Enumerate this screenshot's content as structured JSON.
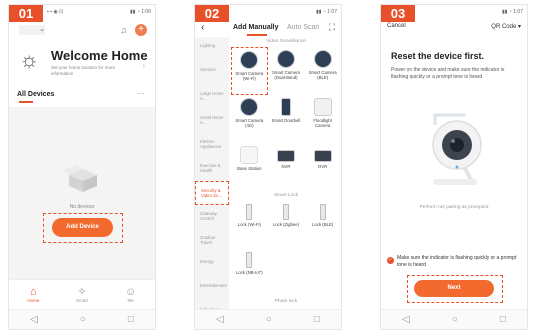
{
  "colors": {
    "accent": "#e8502a",
    "button": "#f36a2e",
    "panel": "#f4f4f4"
  },
  "screen1": {
    "step": "01",
    "welcome_title": "Welcome Home",
    "welcome_sub": "Set your home location for more information",
    "all_devices": "All Devices",
    "more": "···",
    "no_devices": "No devices",
    "add_device": "Add Device",
    "tabs": [
      {
        "label": "Home",
        "icon": "home-icon"
      },
      {
        "label": "Smart",
        "icon": "smart-icon"
      },
      {
        "label": "Me",
        "icon": "me-icon"
      }
    ]
  },
  "screen2": {
    "step": "02",
    "tab_manual": "Add Manually",
    "tab_scan": "Auto Scan",
    "categories": [
      "Lighting",
      "Sensors",
      "Large Home A...",
      "Small Home A...",
      "Kitchen Appliances",
      "Exercise & Health",
      "Security & Video Su...",
      "Gateway Control",
      "Outdoor Travel",
      "Energy",
      "Entertainment",
      "Industry &..."
    ],
    "section_video": "Video Surveillance",
    "video_items": [
      "Smart Camera (Wi-Fi)",
      "Smart Camera (Dual-Band)",
      "Smart Camera (BLE)",
      "Smart Camera (4G)",
      "Smart Doorbell",
      "Floodlight Camera",
      "Base Station",
      "NVR",
      "DVR"
    ],
    "section_lock": "Smart Lock",
    "lock_items": [
      "Lock (Wi-Fi)",
      "Lock (Zigbee)",
      "Lock (BLE)",
      "Lock (NB-IoT)"
    ],
    "section_more": "Photo lock"
  },
  "screen3": {
    "step": "03",
    "cancel": "Cancel",
    "qr": "QR Code ▾",
    "title": "Reset the device first.",
    "desc": "Power on the device and make sure the indicator is flashing quickly or a prompt tone is heard",
    "hint": "Perform net pairing as prompted",
    "confirm": "Make sure the indicator is flashing quickly or a prompt tone is heard",
    "next": "Next"
  }
}
